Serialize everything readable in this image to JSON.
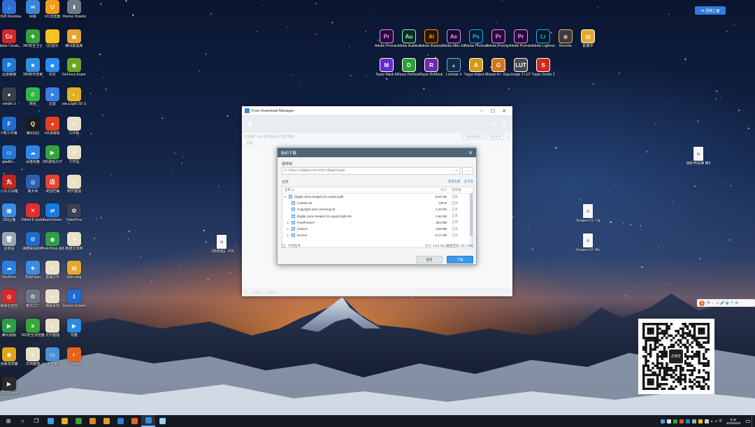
{
  "colors": {
    "fdm_accent": "#3b99ea",
    "dialog_title_bg": "#4d6579",
    "taskbar_bg": "#14181f"
  },
  "desktop_icons": [
    {
      "label": "M3U8 Downloader",
      "color": "#2e6fd8",
      "glyph": "↓",
      "icon": "download-icon"
    },
    {
      "label": "网易",
      "color": "#3a86d6",
      "glyph": "✉",
      "icon": "mail-icon"
    },
    {
      "label": "UC浏览器",
      "color": "#f39c1a",
      "glyph": "U",
      "icon": "uc-browser-icon"
    },
    {
      "label": "Xtreme Downlo...",
      "color": "#6b7a8a",
      "glyph": "⬇",
      "icon": "xtreme-download-icon"
    },
    {
      "label": "Adobe Creati...",
      "color": "#d7252b",
      "glyph": "Cc",
      "icon": "adobe-cc-icon"
    },
    {
      "label": "360安全卫士",
      "color": "#35a338",
      "glyph": "✚",
      "icon": "360-security-icon"
    },
    {
      "label": "QQ音乐",
      "color": "#f2c21a",
      "glyph": "♪",
      "icon": "music-icon"
    },
    {
      "label": "腾讯影视库",
      "color": "#e8a52a",
      "glyph": "▣",
      "icon": "folder-icon"
    },
    {
      "label": "迅雷链接",
      "color": "#1f78d1",
      "glyph": "P",
      "icon": "link-icon"
    },
    {
      "label": "360软件管家",
      "color": "#2f8fe0",
      "glyph": "■",
      "icon": "software-manager-icon"
    },
    {
      "label": "钉钉",
      "color": "#2a8bf2",
      "glyph": "◆",
      "icon": "dingtalk-icon"
    },
    {
      "label": "GeForce Experience",
      "color": "#69a524",
      "glyph": "◉",
      "icon": "geforce-icon"
    },
    {
      "label": "ortrahr 3",
      "color": "#3a3f4a",
      "glyph": "●",
      "icon": "app-icon"
    },
    {
      "label": "微信",
      "color": "#33b34a",
      "glyph": "✆",
      "icon": "wechat-icon"
    },
    {
      "label": "迅雷",
      "color": "#3a7fe0",
      "glyph": "➤",
      "icon": "thunder-icon"
    },
    {
      "label": "set.a.light 3D STUDIO",
      "color": "#e0b120",
      "glyph": "◐",
      "icon": "light-studio-icon"
    },
    {
      "label": "F电工作簿",
      "color": "#1f6fd0",
      "glyph": "F",
      "icon": "workbook-icon"
    },
    {
      "label": "腾讯QQ",
      "color": "#1b1b1b",
      "glyph": "Q",
      "icon": "qq-icon"
    },
    {
      "label": "KK录像机",
      "color": "#e2421e",
      "glyph": "●",
      "icon": "recorder-icon"
    },
    {
      "label": "工作报",
      "color": "#e8e1c8",
      "glyph": "≡",
      "icon": "document-icon"
    },
    {
      "label": "igitalBo...",
      "color": "#2577d6",
      "glyph": "▭",
      "icon": "app-icon"
    },
    {
      "label": "百度网盘",
      "color": "#2f86e6",
      "glyph": "☁",
      "icon": "cloud-drive-icon"
    },
    {
      "label": "360游戏大厅",
      "color": "#35a338",
      "glyph": "▶",
      "icon": "game-icon"
    },
    {
      "label": "工作站",
      "color": "#e8e1c8",
      "glyph": "≡",
      "icon": "document-icon"
    },
    {
      "label": "小丸工具箱",
      "color": "#c2261f",
      "glyph": "丸",
      "icon": "toolbox-icon"
    },
    {
      "label": "鲁大师",
      "color": "#2c5fb4",
      "glyph": "◎",
      "icon": "ludashi-icon"
    },
    {
      "label": "淘宝旺铺",
      "color": "#e8442a",
      "glyph": "店",
      "icon": "shop-icon"
    },
    {
      "label": "软件整理",
      "color": "#e8e1c8",
      "glyph": "≡",
      "icon": "document-icon"
    },
    {
      "label": "360压缩",
      "color": "#3a8be0",
      "glyph": "▦",
      "icon": "zip-icon"
    },
    {
      "label": "XMind 8 Update 7",
      "color": "#e12e2e",
      "glyph": "✕",
      "icon": "xmind-icon"
    },
    {
      "label": "TeamViewer",
      "color": "#1b7ae0",
      "glyph": "⇄",
      "icon": "teamviewer-icon"
    },
    {
      "label": "VideoProc",
      "color": "#3b3f52",
      "glyph": "✿",
      "icon": "videoproc-icon"
    },
    {
      "label": "回收站",
      "color": "#9aa6b2",
      "glyph": "🗑",
      "icon": "recycle-bin-icon"
    },
    {
      "label": "海康威视助手",
      "color": "#1f6bd0",
      "glyph": "⚙",
      "icon": "hik-icon"
    },
    {
      "label": "PhotoShop 图标",
      "color": "#2f9e47",
      "glyph": "◉",
      "icon": "app-icon"
    },
    {
      "label": "新建文本档",
      "color": "#e8e1c8",
      "glyph": "≡",
      "icon": "document-icon"
    },
    {
      "label": "OneDrive",
      "color": "#2a7fe0",
      "glyph": "☁",
      "icon": "onedrive-icon"
    },
    {
      "label": "简易Dpan",
      "color": "#3b8be0",
      "glyph": "◈",
      "icon": "app-icon"
    },
    {
      "label": "直播文件",
      "color": "#e8e1c8",
      "glyph": "≡",
      "icon": "document-icon"
    },
    {
      "label": "Adm.dwg",
      "color": "#e5a82a",
      "glyph": "▤",
      "icon": "dwg-icon"
    },
    {
      "label": "网易云音乐",
      "color": "#d5282b",
      "glyph": "◎",
      "icon": "netease-music-icon"
    },
    {
      "label": "格式工厂",
      "color": "#6d7783",
      "glyph": "⚙",
      "icon": "format-factory-icon"
    },
    {
      "label": "海报素材",
      "color": "#e8e1c8",
      "glyph": "≡",
      "icon": "document-icon"
    },
    {
      "label": "Xtreme Downlo...",
      "color": "#1f6bd0",
      "glyph": "⇩",
      "icon": "xtreme-download-icon"
    },
    {
      "label": "腾讯视频",
      "color": "#2e9d4a",
      "glyph": "▶",
      "icon": "video-icon"
    },
    {
      "label": "360安全浏览器",
      "color": "#3aa53a",
      "glyph": "e",
      "icon": "browser-icon"
    },
    {
      "label": "文件整理",
      "color": "#e8e1c8",
      "glyph": "≡",
      "icon": "document-icon"
    },
    {
      "label": "优酷",
      "color": "#2a8be0",
      "glyph": "▶",
      "icon": "youku-icon"
    },
    {
      "label": "谷歌浏览器",
      "color": "#e2a51a",
      "glyph": "◉",
      "icon": "chrome-icon"
    },
    {
      "label": "文档整理",
      "color": "#e8e1c8",
      "glyph": "≡",
      "icon": "document-icon"
    },
    {
      "label": "此电脑",
      "color": "#4b8fd8",
      "glyph": "▭",
      "icon": "computer-icon"
    },
    {
      "label": "Firefox",
      "color": "#e8631a",
      "glyph": "◐",
      "icon": "firefox-icon"
    },
    {
      "label": "12002.mp4",
      "color": "#2b2b2b",
      "glyph": "▶",
      "icon": "video-file-icon"
    }
  ],
  "adobe_icons": [
    {
      "label": "Adobe Premie...",
      "abbr": "Pr",
      "bg": "#2a0a3a",
      "fg": "#e49bff"
    },
    {
      "label": "Adobe Audition ...",
      "abbr": "Au",
      "bg": "#0a2a24",
      "fg": "#9ff0d8"
    },
    {
      "label": "Adobe Illustrat...",
      "abbr": "Ai",
      "bg": "#2b1500",
      "fg": "#ff9a00"
    },
    {
      "label": "Adobe After Effects CC ...",
      "abbr": "Ae",
      "bg": "#1a0a33",
      "fg": "#d0a0ff"
    },
    {
      "label": "Adobe Photosh...",
      "abbr": "Ps",
      "bg": "#001f33",
      "fg": "#31a8ff"
    },
    {
      "label": "Adobe Premie...",
      "abbr": "Pr",
      "bg": "#2a0a3a",
      "fg": "#e49bff"
    },
    {
      "label": "Adobe Premie...",
      "abbr": "Pr",
      "bg": "#2a0a3a",
      "fg": "#e49bff"
    },
    {
      "label": "Adobe Lightroo...",
      "abbr": "Lr",
      "bg": "#001a2a",
      "fg": "#31a8ff"
    },
    {
      "label": "Resolve",
      "abbr": "◉",
      "bg": "#3a3a4a",
      "fg": "#f0c040"
    },
    {
      "label": "影像作",
      "abbr": "▤",
      "bg": "#e5a82a",
      "fg": "#ffffff"
    },
    {
      "label": "Topaz Mask AI",
      "abbr": "M",
      "bg": "#6a2bd0",
      "fg": "#ffffff"
    },
    {
      "label": "Topaz DeNoise AI",
      "abbr": "D",
      "bg": "#2f9d3a",
      "fg": "#ffffff"
    },
    {
      "label": "Topaz ReMask...",
      "abbr": "R",
      "bg": "#6b2bb0",
      "fg": "#ffffff"
    },
    {
      "label": "Luminar 4",
      "abbr": "▲",
      "bg": "#1a2a40",
      "fg": "#5fb8ff"
    },
    {
      "label": "Topaz Adjust AI",
      "abbr": "A",
      "bg": "#d59a1a",
      "fg": "#ffffff"
    },
    {
      "label": "Topaz A.I. Gigapixel",
      "abbr": "G",
      "bg": "#d5741a",
      "fg": "#ffffff"
    },
    {
      "label": "Image 2 LUT",
      "abbr": "LUT",
      "bg": "#4a4a4a",
      "fg": "#ffffff"
    },
    {
      "label": "Topaz Studio 2",
      "abbr": "S",
      "bg": "#d0281f",
      "fg": "#ffffff"
    }
  ],
  "right_desktop_files": [
    {
      "label": "摄影养成簿 摘要分...",
      "icon": "document-icon"
    },
    {
      "label": "Sospesi 01- Liquid Lig...",
      "icon": "text-file-icon"
    },
    {
      "label": "Sospesi 02- Breakfast ...",
      "icon": "text-file-icon"
    },
    {
      "label": "【简单题】 FDM下载...",
      "icon": "text-file-icon"
    }
  ],
  "tr_pill": {
    "label": "回到上面"
  },
  "fdm": {
    "window_title": "Free Download Manager",
    "banner_text": "欢迎来: FDM 官方网站 BT 客户端中",
    "banner_btn1": "添加播放器",
    "banner_btn2": "添加链接",
    "filter_text": "全部",
    "status_down": "0 B/s",
    "status_up": "0 B/s"
  },
  "dialog": {
    "title": "新的下载",
    "save_to_label": "保存到",
    "path": "C:\\Users\\Administrator\\Downloads",
    "browse": "...",
    "files_label": "文件",
    "select_all": "选择全部",
    "deselect_all": "全不选",
    "col_name": "名称",
    "col_size": "大小",
    "col_priority": "优先级",
    "files": [
      {
        "name": "Digital.Juice.Swipes.01.Liquid.Light",
        "size": "6.94 GB",
        "priority": "正常",
        "level": 0,
        "twisty": "▾"
      },
      {
        "name": "Contact.txt",
        "size": "109 B",
        "priority": "正常",
        "level": 1,
        "twisty": ""
      },
      {
        "name": "Copyright and Licensing.txt",
        "size": "4.24 KB",
        "priority": "正常",
        "level": 1,
        "twisty": ""
      },
      {
        "name": "Digital.Juice.Swipes.01.Liquid.Light.nfo",
        "size": "1.64 KB",
        "priority": "正常",
        "level": 1,
        "twisty": ""
      },
      {
        "name": "FinalFrames",
        "size": "284 MB",
        "priority": "正常",
        "level": 1,
        "twisty": "▸"
      },
      {
        "name": "Juicer3",
        "size": "195 MB",
        "priority": "正常",
        "level": 1,
        "twisty": "▸"
      },
      {
        "name": "Source",
        "size": "6.47 GB",
        "priority": "正常",
        "level": 1,
        "twisty": "▸"
      }
    ],
    "schedule_label": "计划任务",
    "size_summary": "大小: 6.94 GB (磁盘空间: 45.7 GB)",
    "cancel": "取消",
    "download": "下载"
  },
  "qr": {
    "logo_text": "启课堂"
  },
  "ime": {
    "brand": "S",
    "items": "中 ・ ☺ 🎤 ▦ 👕 ⚙"
  },
  "taskbar": {
    "time": "9:32",
    "date": "2020/9/29"
  }
}
